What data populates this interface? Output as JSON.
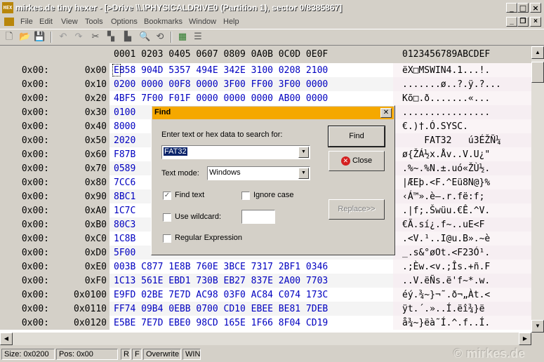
{
  "window": {
    "title": "mirkes.de tiny hexer - [>Drive \\\\.\\PHYSICALDRIVE0 (Partition 1), sector 0/8385867]",
    "icon_label": "HEX",
    "minimize": "_",
    "maximize": "□",
    "close": "×"
  },
  "menu": {
    "items": [
      "File",
      "Edit",
      "View",
      "Tools",
      "Options",
      "Bookmarks",
      "Window",
      "Help"
    ]
  },
  "toolbar": {
    "icons": [
      "new-icon",
      "open-icon",
      "save-icon",
      "undo-icon",
      "redo-icon",
      "cut-icon",
      "copy-icon",
      "paste-icon",
      "find-icon",
      "replace-icon",
      "script-icon",
      "list-icon"
    ]
  },
  "hex": {
    "header_hex": "0001 0203 0405 0607 0809 0A0B 0C0D 0E0F",
    "header_ascii": "0123456789ABCDEF",
    "rows": [
      {
        "a1": "0x00:",
        "a2": "0x00",
        "hex": "EB58 904D 5357 494E 342E 3100 0208 2100",
        "ascii": "ëX□MSWIN4.1...!."
      },
      {
        "a1": "0x00:",
        "a2": "0x10",
        "hex": "0200 0000 00F8 0000 3F00 FF00 3F00 0000",
        "ascii": ".......ø..?.ÿ.?..."
      },
      {
        "a1": "0x00:",
        "a2": "0x20",
        "hex": "4BF5 7F00 F01F 0000 0000 0000 AB00 0000",
        "ascii": "Kõ□.ð.......«..."
      },
      {
        "a1": "0x00:",
        "a2": "0x30",
        "hex": "0100",
        "ascii": "................"
      },
      {
        "a1": "0x00:",
        "a2": "0x40",
        "hex": "8000",
        "ascii": "€.)†.Ó.SYSC."
      },
      {
        "a1": "0x00:",
        "a2": "0x50",
        "hex": "2020",
        "ascii": "    FAT32   ú3ÉŽÑ¼"
      },
      {
        "a1": "0x00:",
        "a2": "0x60",
        "hex": "F87B",
        "ascii": "ø{ŽÁ½x.Åv..V.U¿\""
      },
      {
        "a1": "0x00:",
        "a2": "0x70",
        "hex": "0589",
        "ascii": ".%~.%N.±.uó«ŽÙ½."
      },
      {
        "a1": "0x00:",
        "a2": "0x80",
        "hex": "7CC6",
        "ascii": "|ÆEþ.<F.^Eü8N@}%"
      },
      {
        "a1": "0x00:",
        "a2": "0x90",
        "hex": "8BC1",
        "ascii": "‹Á™».è—.r.fë:f;"
      },
      {
        "a1": "0x00:",
        "a2": "0xA0",
        "hex": "1C7C",
        "ascii": ".|f;.Šwüu.€Ê.^V."
      },
      {
        "a1": "0x00:",
        "a2": "0xB0",
        "hex": "80C3",
        "ascii": "€Ã.sí¿.f~..uE<F"
      },
      {
        "a1": "0x00:",
        "a2": "0xC0",
        "hex": "1C8B",
        "ascii": ".<V.¹..I@u.B».~è"
      },
      {
        "a1": "0x00:",
        "a2": "0xD0",
        "hex": "5F00",
        "ascii": "_.s&°øOt.<F23Ó¹."
      },
      {
        "a1": "0x00:",
        "a2": "0xE0",
        "hex": "003B C877 1E8B 760E 3BCE 7317 2BF1 0346",
        "ascii": ".;Èw.<v.;Îs.+ñ.F"
      },
      {
        "a1": "0x00:",
        "a2": "0xF0",
        "hex": "1C13 561E EBD1 730B EB27 837E 2A00 7703",
        "ascii": "..V.ëÑs.ë'f~*.w."
      },
      {
        "a1": "0x00:",
        "a2": "0x0100",
        "hex": "E9FD 02BE 7E7D AC98 03F0 AC84 C074 173C",
        "ascii": "éý.¾~}¬˜.ð¬„Àt.<"
      },
      {
        "a1": "0x00:",
        "a2": "0x0110",
        "hex": "FF74 09B4 0EBB 0700 CD10 EBEE BE81 7DEB",
        "ascii": "ÿt.´.»..Í.ëî¾}ë"
      },
      {
        "a1": "0x00:",
        "a2": "0x0120",
        "hex": "E5BE 7E7D EBE0 98CD 165E 1F66 8F04 CD19",
        "ascii": "å¾~}ëà˜Í.^.f..Í."
      }
    ]
  },
  "dialog": {
    "title": "Find",
    "prompt": "Enter text or hex data to search for:",
    "search_value": "FAT32",
    "text_mode_label": "Text mode:",
    "text_mode_value": "Windows",
    "find_text_label": "Find text",
    "ignore_case_label": "Ignore case",
    "wildcard_label": "Use wildcard:",
    "regex_label": "Regular Expression",
    "find_button": "Find",
    "close_button": "Close",
    "replace_button": "Replace>>",
    "find_text_checked": true,
    "ignore_case_checked": false,
    "wildcard_checked": false,
    "regex_checked": false
  },
  "status": {
    "size": "Size: 0x0200",
    "pos": "Pos: 0x00",
    "r": "R",
    "f": "F",
    "mode": "Overwrite",
    "charset": "WIN"
  },
  "watermark": "© mirkes.de"
}
